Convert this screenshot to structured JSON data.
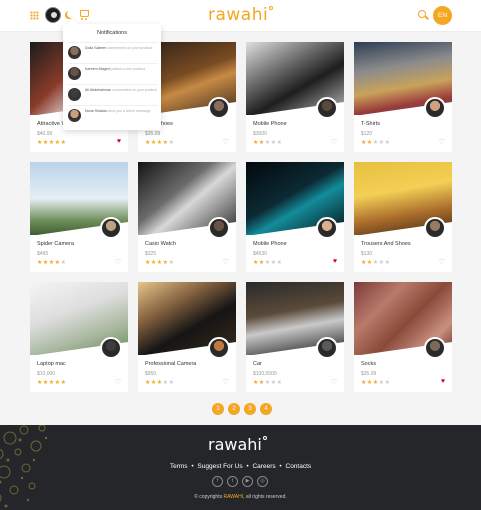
{
  "header": {
    "brand": "rawahi",
    "lang_label": "EN"
  },
  "notifications": {
    "heading": "Notifications",
    "items": [
      {
        "name": "Dolla Saleem",
        "text": "commented on your product",
        "avatar_color": "#8a6d5a"
      },
      {
        "name": "Kareem Maged",
        "text": "posted a new product",
        "avatar_color": "#6b5246"
      },
      {
        "name": "Ali Abdelrahman",
        "text": "commented on your product",
        "avatar_color": "#3d3d3d"
      },
      {
        "name": "Nona Shalaia",
        "text": "send you a direct message",
        "avatar_color": "#c9a27d"
      }
    ]
  },
  "products": [
    {
      "title": "Attractive W...",
      "price": "$40.99",
      "rating": 5,
      "liked": true
    },
    {
      "title": "...nd Shoes",
      "price": "$35.99",
      "rating": 4,
      "liked": false
    },
    {
      "title": "Mobile Phone",
      "price": "$3000",
      "rating": 2,
      "liked": false
    },
    {
      "title": "T-Shirts",
      "price": "$120",
      "rating": 2,
      "liked": false
    },
    {
      "title": "Spider Camera",
      "price": "$495",
      "rating": 4,
      "liked": false
    },
    {
      "title": "Casio Watch",
      "price": "$325",
      "rating": 4,
      "liked": false
    },
    {
      "title": "Mobile Phone",
      "price": "$4530",
      "rating": 2,
      "liked": true
    },
    {
      "title": "Trousers And Shoes",
      "price": "$130",
      "rating": 2,
      "liked": false
    },
    {
      "title": "Laptop mac",
      "price": "$10,000",
      "rating": 5,
      "liked": false
    },
    {
      "title": "Professional Camera",
      "price": "$950",
      "rating": 3,
      "liked": false
    },
    {
      "title": "Car",
      "price": "$100,5500",
      "rating": 2,
      "liked": false
    },
    {
      "title": "Socks",
      "price": "$35.99",
      "rating": 3,
      "liked": true
    }
  ],
  "pagination": [
    "1",
    "2",
    "3",
    "4"
  ],
  "footer": {
    "brand": "rawahi",
    "links": [
      "Terms",
      "Suggest For Us",
      "Careers",
      "Contacts"
    ],
    "copyright_prefix": "© copyrights",
    "copyright_brand": "RAWAHI",
    "copyright_suffix": "all rights reserved."
  },
  "colors": {
    "accent": "#f5a623",
    "footer_bg": "#25262a",
    "like": "#d0021b"
  }
}
